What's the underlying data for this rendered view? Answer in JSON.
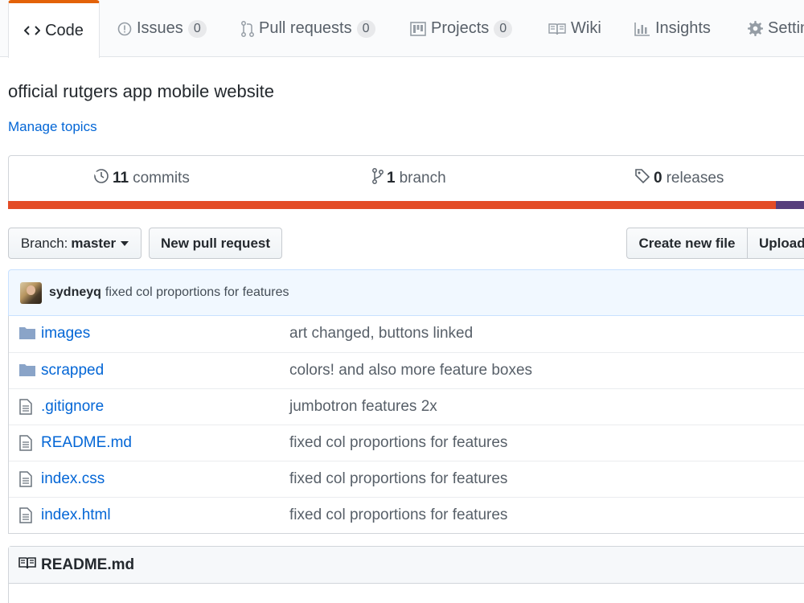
{
  "tabs": [
    {
      "label": "Code",
      "icon": "code-icon"
    },
    {
      "label": "Issues",
      "icon": "issue-opened-icon",
      "count": "0"
    },
    {
      "label": "Pull requests",
      "icon": "git-pull-request-icon",
      "count": "0"
    },
    {
      "label": "Projects",
      "icon": "project-icon",
      "count": "0"
    },
    {
      "label": "Wiki",
      "icon": "book-icon"
    },
    {
      "label": "Insights",
      "icon": "graph-icon"
    },
    {
      "label": "Settin",
      "icon": "gear-icon"
    }
  ],
  "repo": {
    "description": "official rutgers app mobile website",
    "manage_topics": "Manage topics"
  },
  "summary": {
    "commits_count": "11",
    "commits_label": "commits",
    "branches_count": "1",
    "branches_label": "branch",
    "releases_count": "0",
    "releases_label": "releases"
  },
  "language_colors": {
    "primary": "#e34c26",
    "secondary": "#563d7c"
  },
  "toolbar": {
    "branch_label": "Branch:",
    "branch_value": "master",
    "new_pr": "New pull request",
    "create_file": "Create new file",
    "upload": "Upload"
  },
  "latest_commit": {
    "author": "sydneyq",
    "message": "fixed col proportions for features"
  },
  "files": [
    {
      "name": "images",
      "type": "folder",
      "message": "art changed, buttons linked"
    },
    {
      "name": "scrapped",
      "type": "folder",
      "message": "colors! and also more feature boxes"
    },
    {
      "name": ".gitignore",
      "type": "file",
      "message": "jumbotron features 2x"
    },
    {
      "name": "README.md",
      "type": "file",
      "message": "fixed col proportions for features"
    },
    {
      "name": "index.css",
      "type": "file",
      "message": "fixed col proportions for features"
    },
    {
      "name": "index.html",
      "type": "file",
      "message": "fixed col proportions for features"
    }
  ],
  "readme": {
    "title": "README.md"
  }
}
